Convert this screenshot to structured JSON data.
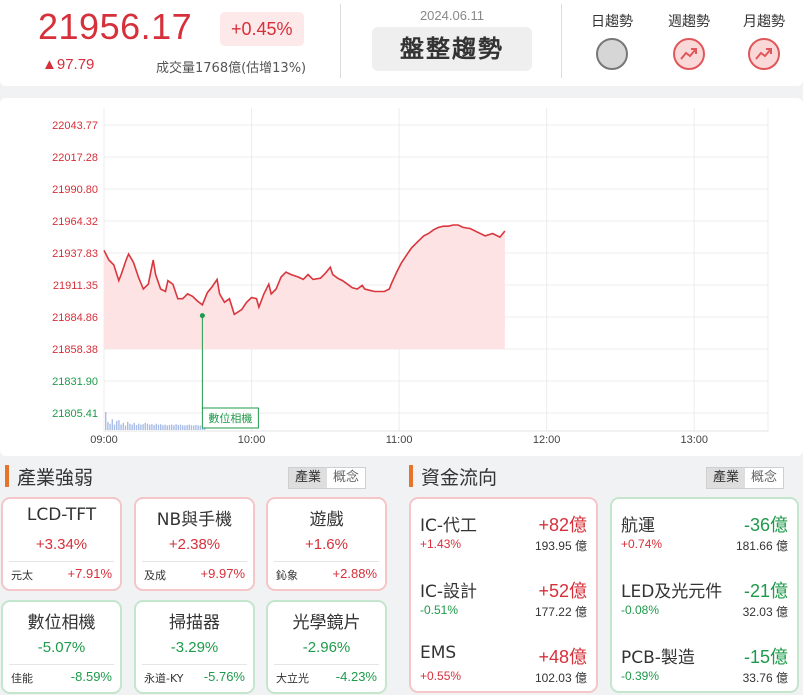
{
  "header": {
    "price": "21956.17",
    "pct_change": "+0.45%",
    "change": "▲97.79",
    "volume": "成交量1768億(估增13%)",
    "date": "2024.06.11",
    "trend_title": "盤整趨勢",
    "trend_daily_label": "日趨勢",
    "trend_weekly_label": "週趨勢",
    "trend_monthly_label": "月趨勢",
    "trend_daily_state": "neutral",
    "trend_weekly_state": "up",
    "trend_monthly_state": "up"
  },
  "chart_data": {
    "type": "line",
    "y_ticks": [
      "22043.77",
      "22017.28",
      "21990.80",
      "21964.32",
      "21937.83",
      "21911.35",
      "21884.86",
      "21858.38",
      "21831.90",
      "21805.41"
    ],
    "ylim": [
      21805.41,
      22043.77
    ],
    "x_ticks": [
      "09:00",
      "10:00",
      "11:00",
      "12:00",
      "13:00"
    ],
    "x_range_minutes": [
      0,
      270
    ],
    "reference_value": 21858.38,
    "series": [
      {
        "minutes": [
          0,
          2,
          4,
          6,
          7,
          9,
          10,
          12,
          14,
          16,
          18,
          20,
          21,
          23,
          25,
          26,
          28,
          30,
          32,
          34,
          36,
          38,
          40,
          42,
          44,
          46,
          47,
          49,
          51,
          53,
          56,
          58,
          60,
          62,
          63,
          65,
          67,
          68,
          70,
          72,
          74,
          76,
          79,
          81,
          83,
          85,
          88,
          90,
          92,
          93,
          95,
          97,
          99,
          101,
          103,
          105,
          106,
          108,
          110,
          112,
          114,
          116,
          117,
          119,
          121,
          123,
          125,
          127,
          129,
          130,
          132,
          134,
          136,
          138,
          140,
          142,
          144,
          146,
          149,
          152,
          155,
          158,
          161,
          163
        ],
        "values": [
          21940.0,
          21932.0,
          21928.0,
          21915.0,
          21920.0,
          21932.0,
          21937.0,
          21930.0,
          21918.0,
          21908.0,
          21912.0,
          21932.0,
          21920.0,
          21908.0,
          21906.0,
          21915.0,
          21912.0,
          21900.0,
          21900.0,
          21904.0,
          21902.0,
          21898.0,
          21895.0,
          21905.0,
          21910.0,
          21916.0,
          21904.0,
          21897.0,
          21900.0,
          21887.0,
          21891.0,
          21897.0,
          21901.0,
          21900.0,
          21893.0,
          21904.0,
          21912.0,
          21904.0,
          21908.0,
          21918.0,
          21922.0,
          21920.0,
          21918.0,
          21916.0,
          21920.0,
          21916.0,
          21917.0,
          21921.0,
          21926.0,
          21920.0,
          21917.0,
          21915.0,
          21912.0,
          21909.0,
          21908.0,
          21911.0,
          21908.0,
          21907.0,
          21906.0,
          21906.0,
          21906.0,
          21908.0,
          21913.0,
          21922.0,
          21930.0,
          21936.0,
          21942.0,
          21946.0,
          21950.0,
          21952.0,
          21954.0,
          21957.0,
          21959.0,
          21960.0,
          21960.0,
          21961.0,
          21961.0,
          21959.0,
          21958.0,
          21955.0,
          21952.0,
          21954.0,
          21951.0,
          21956.0
        ]
      }
    ],
    "volume_bars": [
      1.0,
      0.45,
      0.35,
      0.6,
      0.3,
      0.5,
      0.55,
      0.3,
      0.4,
      0.25,
      0.45,
      0.35,
      0.3,
      0.4,
      0.28,
      0.35,
      0.3,
      0.32,
      0.4,
      0.35,
      0.3,
      0.33,
      0.28,
      0.35,
      0.3,
      0.32,
      0.27,
      0.3,
      0.25,
      0.28,
      0.3,
      0.26,
      0.32,
      0.28,
      0.3,
      0.26,
      0.25,
      0.28,
      0.3,
      0.27,
      0.25,
      0.28,
      0.26,
      0.25,
      0.3,
      0.27
    ],
    "annotation": {
      "label": "數位相機",
      "minute": 40,
      "value": 21886.0
    }
  },
  "industry": {
    "title": "產業強弱",
    "tab_industry": "產業",
    "tab_concept": "概念",
    "tiles": [
      {
        "name": "LCD-TFT",
        "pct": "+3.34%",
        "stock": "元太",
        "stock_pct": "+7.91%",
        "dir": "up"
      },
      {
        "name": "NB與手機",
        "pct": "+2.38%",
        "stock": "及成",
        "stock_pct": "+9.97%",
        "dir": "up"
      },
      {
        "name": "遊戲",
        "pct": "+1.6%",
        "stock": "鈊象",
        "stock_pct": "+2.88%",
        "dir": "up"
      },
      {
        "name": "數位相機",
        "pct": "-5.07%",
        "stock": "佳能",
        "stock_pct": "-8.59%",
        "dir": "down"
      },
      {
        "name": "掃描器",
        "pct": "-3.29%",
        "stock": "永道-KY",
        "stock_pct": "-5.76%",
        "dir": "down"
      },
      {
        "name": "光學鏡片",
        "pct": "-2.96%",
        "stock": "大立光",
        "stock_pct": "-4.23%",
        "dir": "down"
      }
    ]
  },
  "flow": {
    "title": "資金流向",
    "tab_industry": "產業",
    "tab_concept": "概念",
    "inflow": [
      {
        "name": "IC-代工",
        "amount": "+82億",
        "pct": "+1.43%",
        "value": "193.95 億"
      },
      {
        "name": "IC-設計",
        "amount": "+52億",
        "pct": "-0.51%",
        "value": "177.22 億"
      },
      {
        "name": "EMS",
        "amount": "+48億",
        "pct": "+0.55%",
        "value": "102.03 億"
      }
    ],
    "outflow": [
      {
        "name": "航運",
        "amount": "-36億",
        "pct": "+0.74%",
        "value": "181.66 億"
      },
      {
        "name": "LED及光元件",
        "amount": "-21億",
        "pct": "-0.08%",
        "value": "32.03 億"
      },
      {
        "name": "PCB-製造",
        "amount": "-15億",
        "pct": "-0.39%",
        "value": "33.76 億"
      }
    ]
  },
  "colors": {
    "up": "#d6303a",
    "down": "#1e9a4a",
    "accent": "#e6752b"
  }
}
